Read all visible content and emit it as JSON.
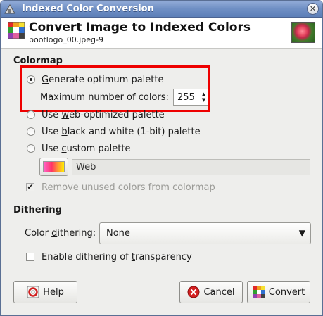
{
  "window": {
    "title": "Indexed Color Conversion",
    "close_glyph": "✕"
  },
  "header": {
    "title": "Convert Image to Indexed Colors",
    "subtitle": "bootlogo_00.jpeg-9"
  },
  "colormap": {
    "section_title": "Colormap",
    "options": {
      "optimum": {
        "pre": "",
        "ul": "G",
        "post": "enerate optimum palette",
        "selected": true
      },
      "max_colors": {
        "pre": "",
        "ul": "M",
        "post": "aximum number of colors:",
        "value": "255"
      },
      "web": {
        "pre": "Use ",
        "ul": "w",
        "post": "eb-optimized palette",
        "selected": false
      },
      "bw": {
        "pre": "Use ",
        "ul": "b",
        "post": "lack and white (1-bit) palette",
        "selected": false
      },
      "custom": {
        "pre": "Use ",
        "ul": "c",
        "post": "ustom palette",
        "selected": false
      }
    },
    "palette_name": "Web",
    "remove_unused": {
      "pre": "",
      "ul": "R",
      "post": "emove unused colors from colormap",
      "checked": true,
      "disabled": true
    }
  },
  "dithering": {
    "section_title": "Dithering",
    "color_dithering": {
      "pre": "Color ",
      "ul": "d",
      "post": "ithering:",
      "value": "None"
    },
    "transparency": {
      "pre": "Enable dithering of ",
      "ul": "t",
      "post": "ransparency",
      "checked": false
    }
  },
  "buttons": {
    "help": {
      "pre": "",
      "ul": "H",
      "post": "elp"
    },
    "cancel": {
      "pre": "",
      "ul": "C",
      "post": "ancel"
    },
    "convert": {
      "pre": "",
      "ul": "C",
      "post": "onvert"
    }
  },
  "icons": {
    "window": "palette-icon",
    "header": "indexed-colors-icon",
    "help": "lifebuoy-icon",
    "cancel": "cancel-icon",
    "convert": "indexed-colors-icon"
  },
  "colors": {
    "highlight": "#ee0000",
    "titlebar": "#6f8fc4"
  }
}
